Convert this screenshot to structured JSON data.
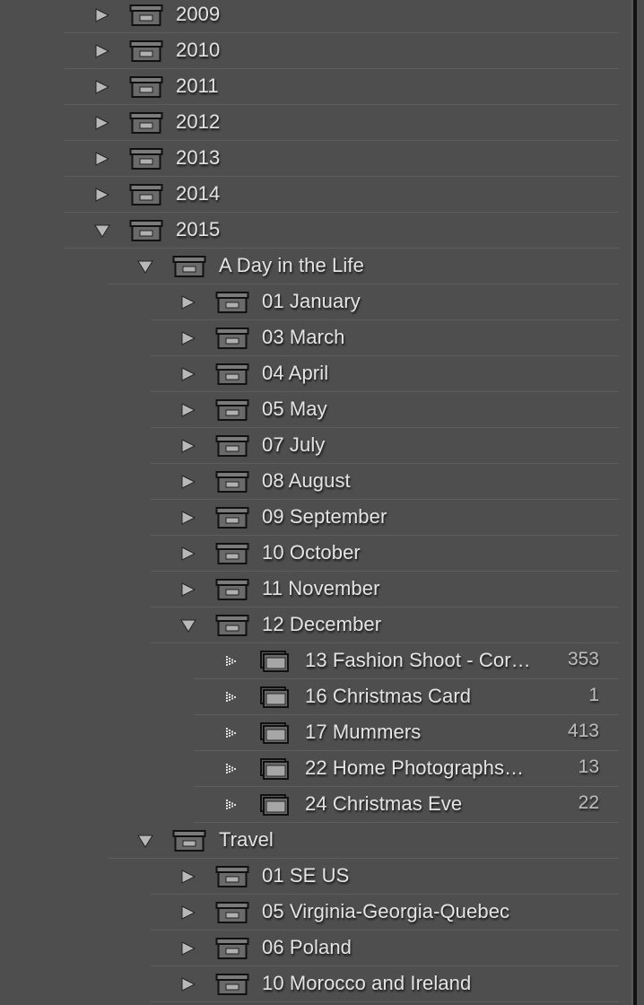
{
  "folders": [
    {
      "label": "2009",
      "level": 0,
      "state": "collapsed",
      "icon": "folder-box-icon"
    },
    {
      "label": "2010",
      "level": 0,
      "state": "collapsed",
      "icon": "folder-box-icon"
    },
    {
      "label": "2011",
      "level": 0,
      "state": "collapsed",
      "icon": "folder-box-icon"
    },
    {
      "label": "2012",
      "level": 0,
      "state": "collapsed",
      "icon": "folder-box-icon"
    },
    {
      "label": "2013",
      "level": 0,
      "state": "collapsed",
      "icon": "folder-box-icon"
    },
    {
      "label": "2014",
      "level": 0,
      "state": "collapsed",
      "icon": "folder-box-icon"
    },
    {
      "label": "2015",
      "level": 0,
      "state": "expanded",
      "icon": "folder-box-icon"
    },
    {
      "label": "A Day in the Life",
      "level": 1,
      "state": "expanded",
      "icon": "folder-box-icon"
    },
    {
      "label": "01 January",
      "level": 2,
      "state": "collapsed",
      "icon": "folder-box-icon"
    },
    {
      "label": "03 March",
      "level": 2,
      "state": "collapsed",
      "icon": "folder-box-icon"
    },
    {
      "label": "04 April",
      "level": 2,
      "state": "collapsed",
      "icon": "folder-box-icon"
    },
    {
      "label": "05 May",
      "level": 2,
      "state": "collapsed",
      "icon": "folder-box-icon"
    },
    {
      "label": "07 July",
      "level": 2,
      "state": "collapsed",
      "icon": "folder-box-icon"
    },
    {
      "label": "08 August",
      "level": 2,
      "state": "collapsed",
      "icon": "folder-box-icon"
    },
    {
      "label": "09 September",
      "level": 2,
      "state": "collapsed",
      "icon": "folder-box-icon"
    },
    {
      "label": "10 October",
      "level": 2,
      "state": "collapsed",
      "icon": "folder-box-icon"
    },
    {
      "label": "11 November",
      "level": 2,
      "state": "collapsed",
      "icon": "folder-box-icon"
    },
    {
      "label": "12 December",
      "level": 2,
      "state": "expanded",
      "icon": "folder-box-icon"
    },
    {
      "label": "13 Fashion Shoot - Cor…",
      "level": 3,
      "state": "leaf",
      "icon": "photo-folder-icon",
      "count": "353"
    },
    {
      "label": "16 Christmas Card",
      "level": 3,
      "state": "leaf",
      "icon": "photo-folder-icon",
      "count": "1"
    },
    {
      "label": "17 Mummers",
      "level": 3,
      "state": "leaf",
      "icon": "photo-folder-icon",
      "count": "413"
    },
    {
      "label": "22 Home Photographs…",
      "level": 3,
      "state": "leaf",
      "icon": "photo-folder-icon",
      "count": "13"
    },
    {
      "label": "24 Christmas Eve",
      "level": 3,
      "state": "leaf",
      "icon": "photo-folder-icon",
      "count": "22"
    },
    {
      "label": "Travel",
      "level": 1,
      "state": "expanded",
      "icon": "folder-box-icon"
    },
    {
      "label": "01 SE US",
      "level": 2,
      "state": "collapsed",
      "icon": "folder-box-icon"
    },
    {
      "label": "05 Virginia-Georgia-Quebec",
      "level": 2,
      "state": "collapsed",
      "icon": "folder-box-icon"
    },
    {
      "label": "06 Poland",
      "level": 2,
      "state": "collapsed",
      "icon": "folder-box-icon"
    },
    {
      "label": "10 Morocco and Ireland",
      "level": 2,
      "state": "collapsed",
      "icon": "folder-box-icon"
    }
  ],
  "colors": {
    "background": "#4e4e4e",
    "text": "#e4e4e4",
    "count": "#bdbdbd",
    "triangle": "#b8b8b8"
  }
}
